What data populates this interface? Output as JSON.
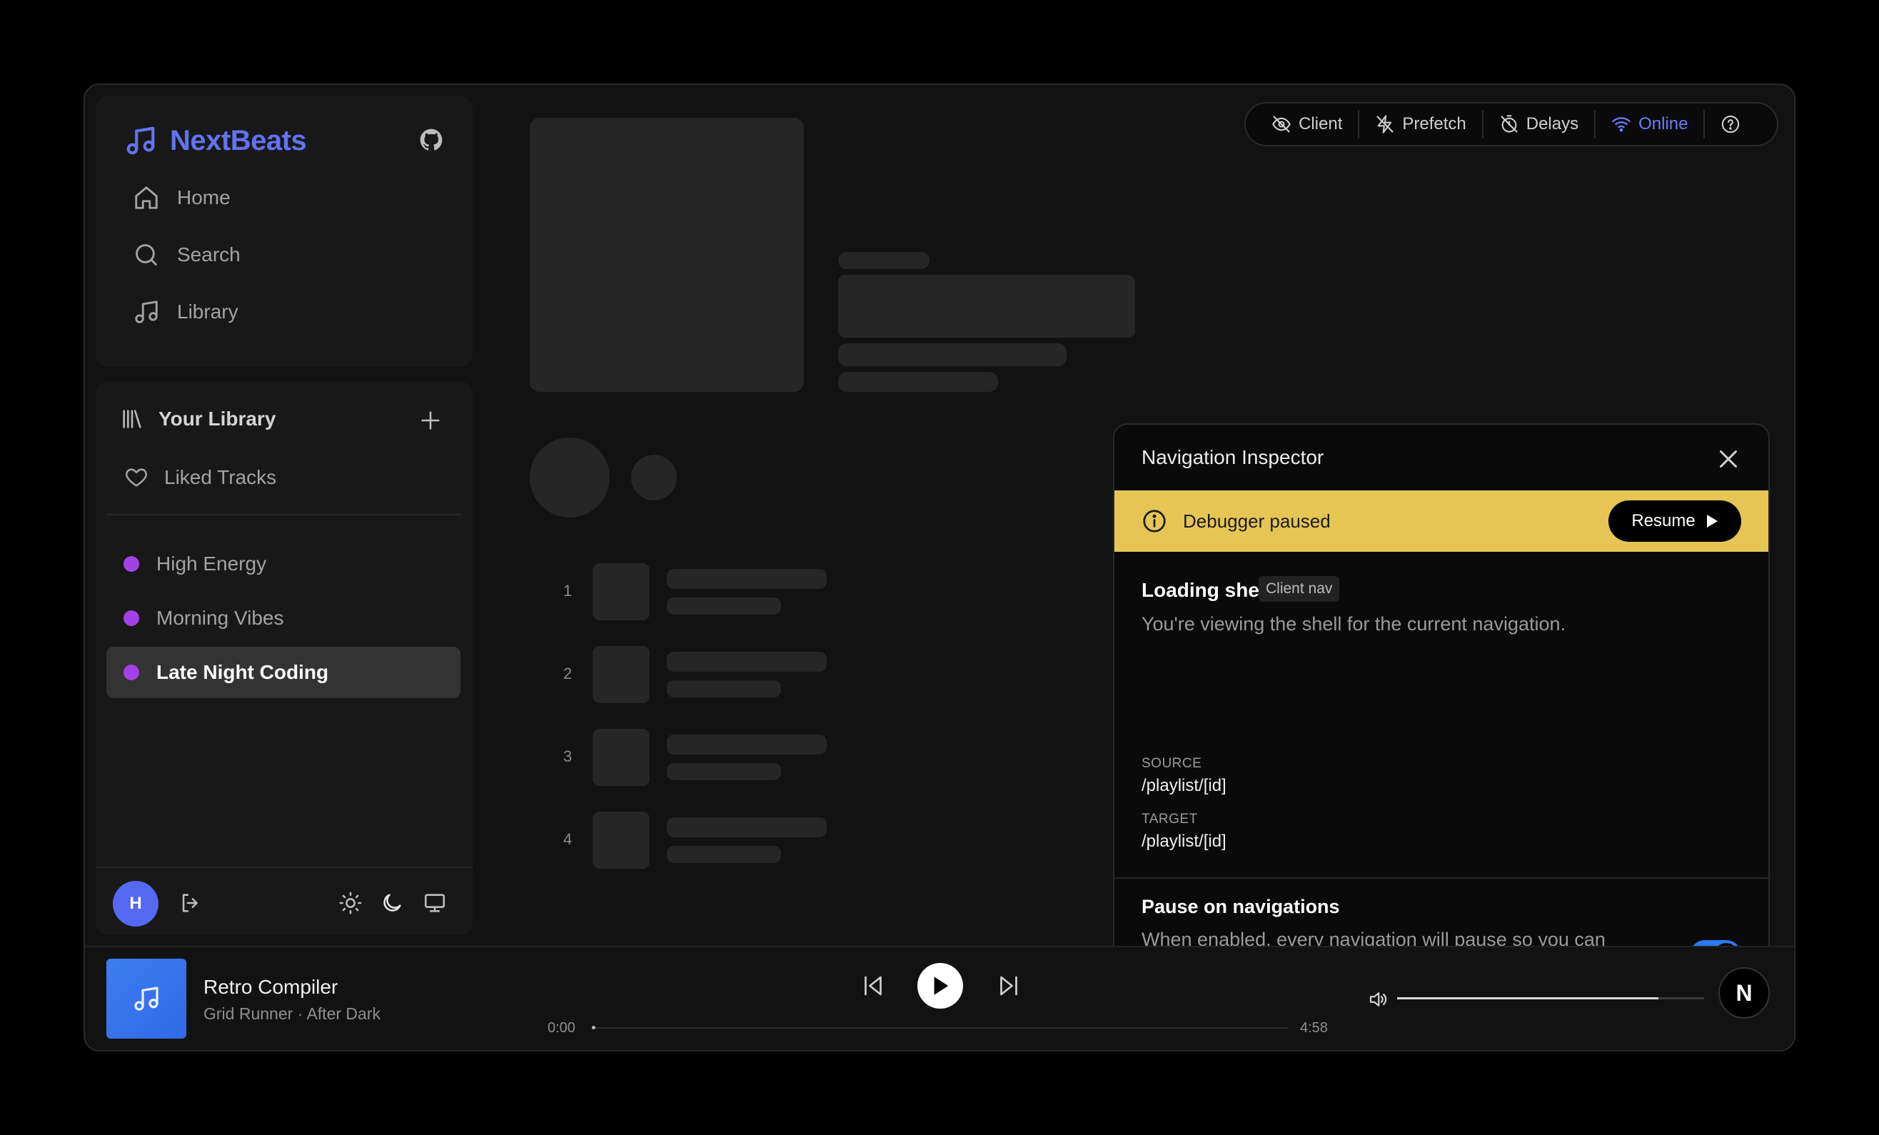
{
  "brand": {
    "name": "NextBeats"
  },
  "nav": [
    {
      "label": "Home"
    },
    {
      "label": "Search"
    },
    {
      "label": "Library"
    }
  ],
  "library": {
    "title": "Your Library",
    "liked": "Liked Tracks",
    "playlists": [
      {
        "name": "High Energy",
        "active": false
      },
      {
        "name": "Morning Vibes",
        "active": false
      },
      {
        "name": "Late Night Coding",
        "active": true
      }
    ]
  },
  "user": {
    "initial": "H"
  },
  "skeleton": {
    "rows": [
      "1",
      "2",
      "3",
      "4"
    ]
  },
  "devbar": {
    "client": "Client",
    "prefetch": "Prefetch",
    "delays": "Delays",
    "online": "Online"
  },
  "inspector": {
    "title": "Navigation Inspector",
    "banner": "Debugger paused",
    "resume": "Resume",
    "shell_title": "Loading shell",
    "shell_badge": "Client nav",
    "shell_desc": "You're viewing the shell for the current navigation.",
    "source_label": "SOURCE",
    "source_value": "/playlist/[id]",
    "target_label": "TARGET",
    "target_value": "/playlist/[id]",
    "pause_title": "Pause on navigations",
    "pause_desc": "When enabled, every navigation will pause so you can inspect the loading shell before resuming.",
    "pause_enabled": true
  },
  "player": {
    "title": "Retro Compiler",
    "subtitle": "Grid Runner · After Dark",
    "elapsed": "0:00",
    "duration": "4:58",
    "progress": 0,
    "volume": 0.85
  },
  "colors": {
    "accent": "#6272f0",
    "banner": "#e6c555",
    "playlist_dot": "#a341e6",
    "toggle": "#2b7bf0"
  }
}
